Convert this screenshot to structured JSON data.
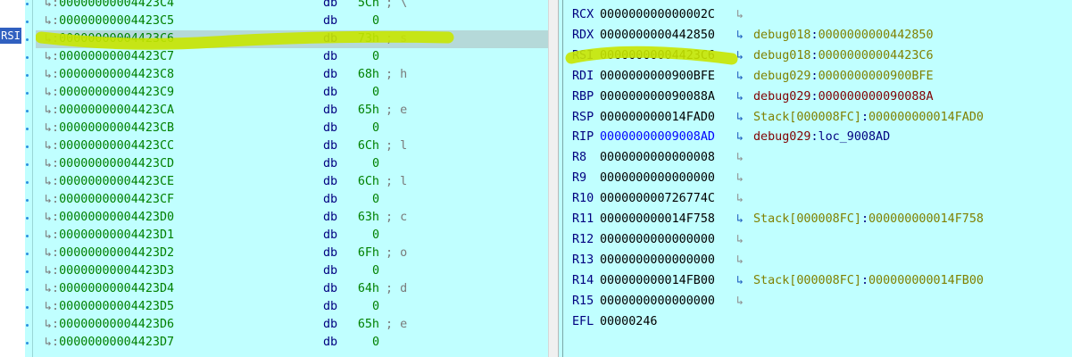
{
  "colors": {
    "background": "#c0ffff",
    "highlight_row": "#b5d9d9",
    "marker": "#c8e600",
    "address": "#008000",
    "mnemonic": "#000080",
    "comment": "#7a7a7a",
    "register_name": "#000080",
    "reference": "#808000"
  },
  "disasm": {
    "rsi_label": "RSI",
    "rows": [
      {
        "prefix": "↳:",
        "address": "00000000004423C4",
        "mnemonic": "db",
        "value": "5Ch",
        "comment": "; \\"
      },
      {
        "prefix": "↳:",
        "address": "00000000004423C5",
        "mnemonic": "db",
        "value": "0",
        "comment": ""
      },
      {
        "prefix": "↳:",
        "address": "00000000004423C6",
        "mnemonic": "db",
        "value": "73h",
        "comment": "; s"
      },
      {
        "prefix": "↳:",
        "address": "00000000004423C7",
        "mnemonic": "db",
        "value": "0",
        "comment": ""
      },
      {
        "prefix": "↳:",
        "address": "00000000004423C8",
        "mnemonic": "db",
        "value": "68h",
        "comment": "; h"
      },
      {
        "prefix": "↳:",
        "address": "00000000004423C9",
        "mnemonic": "db",
        "value": "0",
        "comment": ""
      },
      {
        "prefix": "↳:",
        "address": "00000000004423CA",
        "mnemonic": "db",
        "value": "65h",
        "comment": "; e"
      },
      {
        "prefix": "↳:",
        "address": "00000000004423CB",
        "mnemonic": "db",
        "value": "0",
        "comment": ""
      },
      {
        "prefix": "↳:",
        "address": "00000000004423CC",
        "mnemonic": "db",
        "value": "6Ch",
        "comment": "; l"
      },
      {
        "prefix": "↳:",
        "address": "00000000004423CD",
        "mnemonic": "db",
        "value": "0",
        "comment": ""
      },
      {
        "prefix": "↳:",
        "address": "00000000004423CE",
        "mnemonic": "db",
        "value": "6Ch",
        "comment": "; l"
      },
      {
        "prefix": "↳:",
        "address": "00000000004423CF",
        "mnemonic": "db",
        "value": "0",
        "comment": ""
      },
      {
        "prefix": "↳:",
        "address": "00000000004423D0",
        "mnemonic": "db",
        "value": "63h",
        "comment": "; c"
      },
      {
        "prefix": "↳:",
        "address": "00000000004423D1",
        "mnemonic": "db",
        "value": "0",
        "comment": ""
      },
      {
        "prefix": "↳:",
        "address": "00000000004423D2",
        "mnemonic": "db",
        "value": "6Fh",
        "comment": "; o"
      },
      {
        "prefix": "↳:",
        "address": "00000000004423D3",
        "mnemonic": "db",
        "value": "0",
        "comment": ""
      },
      {
        "prefix": "↳:",
        "address": "00000000004423D4",
        "mnemonic": "db",
        "value": "64h",
        "comment": "; d"
      },
      {
        "prefix": "↳:",
        "address": "00000000004423D5",
        "mnemonic": "db",
        "value": "0",
        "comment": ""
      },
      {
        "prefix": "↳:",
        "address": "00000000004423D6",
        "mnemonic": "db",
        "value": "65h",
        "comment": "; e"
      },
      {
        "prefix": "↳:",
        "address": "00000000004423D7",
        "mnemonic": "db",
        "value": "0",
        "comment": ""
      }
    ]
  },
  "registers": {
    "rows": [
      {
        "name": "RCX",
        "value": "000000000000002C",
        "arrow": "inactive",
        "segment": "",
        "target": ""
      },
      {
        "name": "RDX",
        "value": "0000000000442850",
        "arrow": "active",
        "segment": "debug018",
        "target": "0000000000442850"
      },
      {
        "name": "RSI",
        "value": "00000000004423C6",
        "arrow": "active",
        "segment": "debug018",
        "target": "00000000004423C6"
      },
      {
        "name": "RDI",
        "value": "0000000000900BFE",
        "arrow": "active",
        "segment": "debug029",
        "target": "0000000000900BFE"
      },
      {
        "name": "RBP",
        "value": "000000000090088A",
        "arrow": "active",
        "segment": "debug029",
        "target": "000000000090088A"
      },
      {
        "name": "RSP",
        "value": "000000000014FAD0",
        "arrow": "active",
        "segment": "Stack[000008FC]",
        "target": "000000000014FAD0"
      },
      {
        "name": "RIP",
        "value": "00000000009008AD",
        "arrow": "active",
        "segment": "debug029",
        "target": "loc_9008AD"
      },
      {
        "name": "R8",
        "value": "0000000000000008",
        "arrow": "inactive",
        "segment": "",
        "target": ""
      },
      {
        "name": "R9",
        "value": "0000000000000000",
        "arrow": "inactive",
        "segment": "",
        "target": ""
      },
      {
        "name": "R10",
        "value": "000000000726774C",
        "arrow": "inactive",
        "segment": "",
        "target": ""
      },
      {
        "name": "R11",
        "value": "000000000014F758",
        "arrow": "active",
        "segment": "Stack[000008FC]",
        "target": "000000000014F758"
      },
      {
        "name": "R12",
        "value": "0000000000000000",
        "arrow": "inactive",
        "segment": "",
        "target": ""
      },
      {
        "name": "R13",
        "value": "0000000000000000",
        "arrow": "inactive",
        "segment": "",
        "target": ""
      },
      {
        "name": "R14",
        "value": "000000000014FB00",
        "arrow": "active",
        "segment": "Stack[000008FC]",
        "target": "000000000014FB00"
      },
      {
        "name": "R15",
        "value": "0000000000000000",
        "arrow": "inactive",
        "segment": "",
        "target": ""
      },
      {
        "name": "EFL",
        "value": "00000246",
        "arrow": "none",
        "segment": "",
        "target": ""
      }
    ]
  }
}
